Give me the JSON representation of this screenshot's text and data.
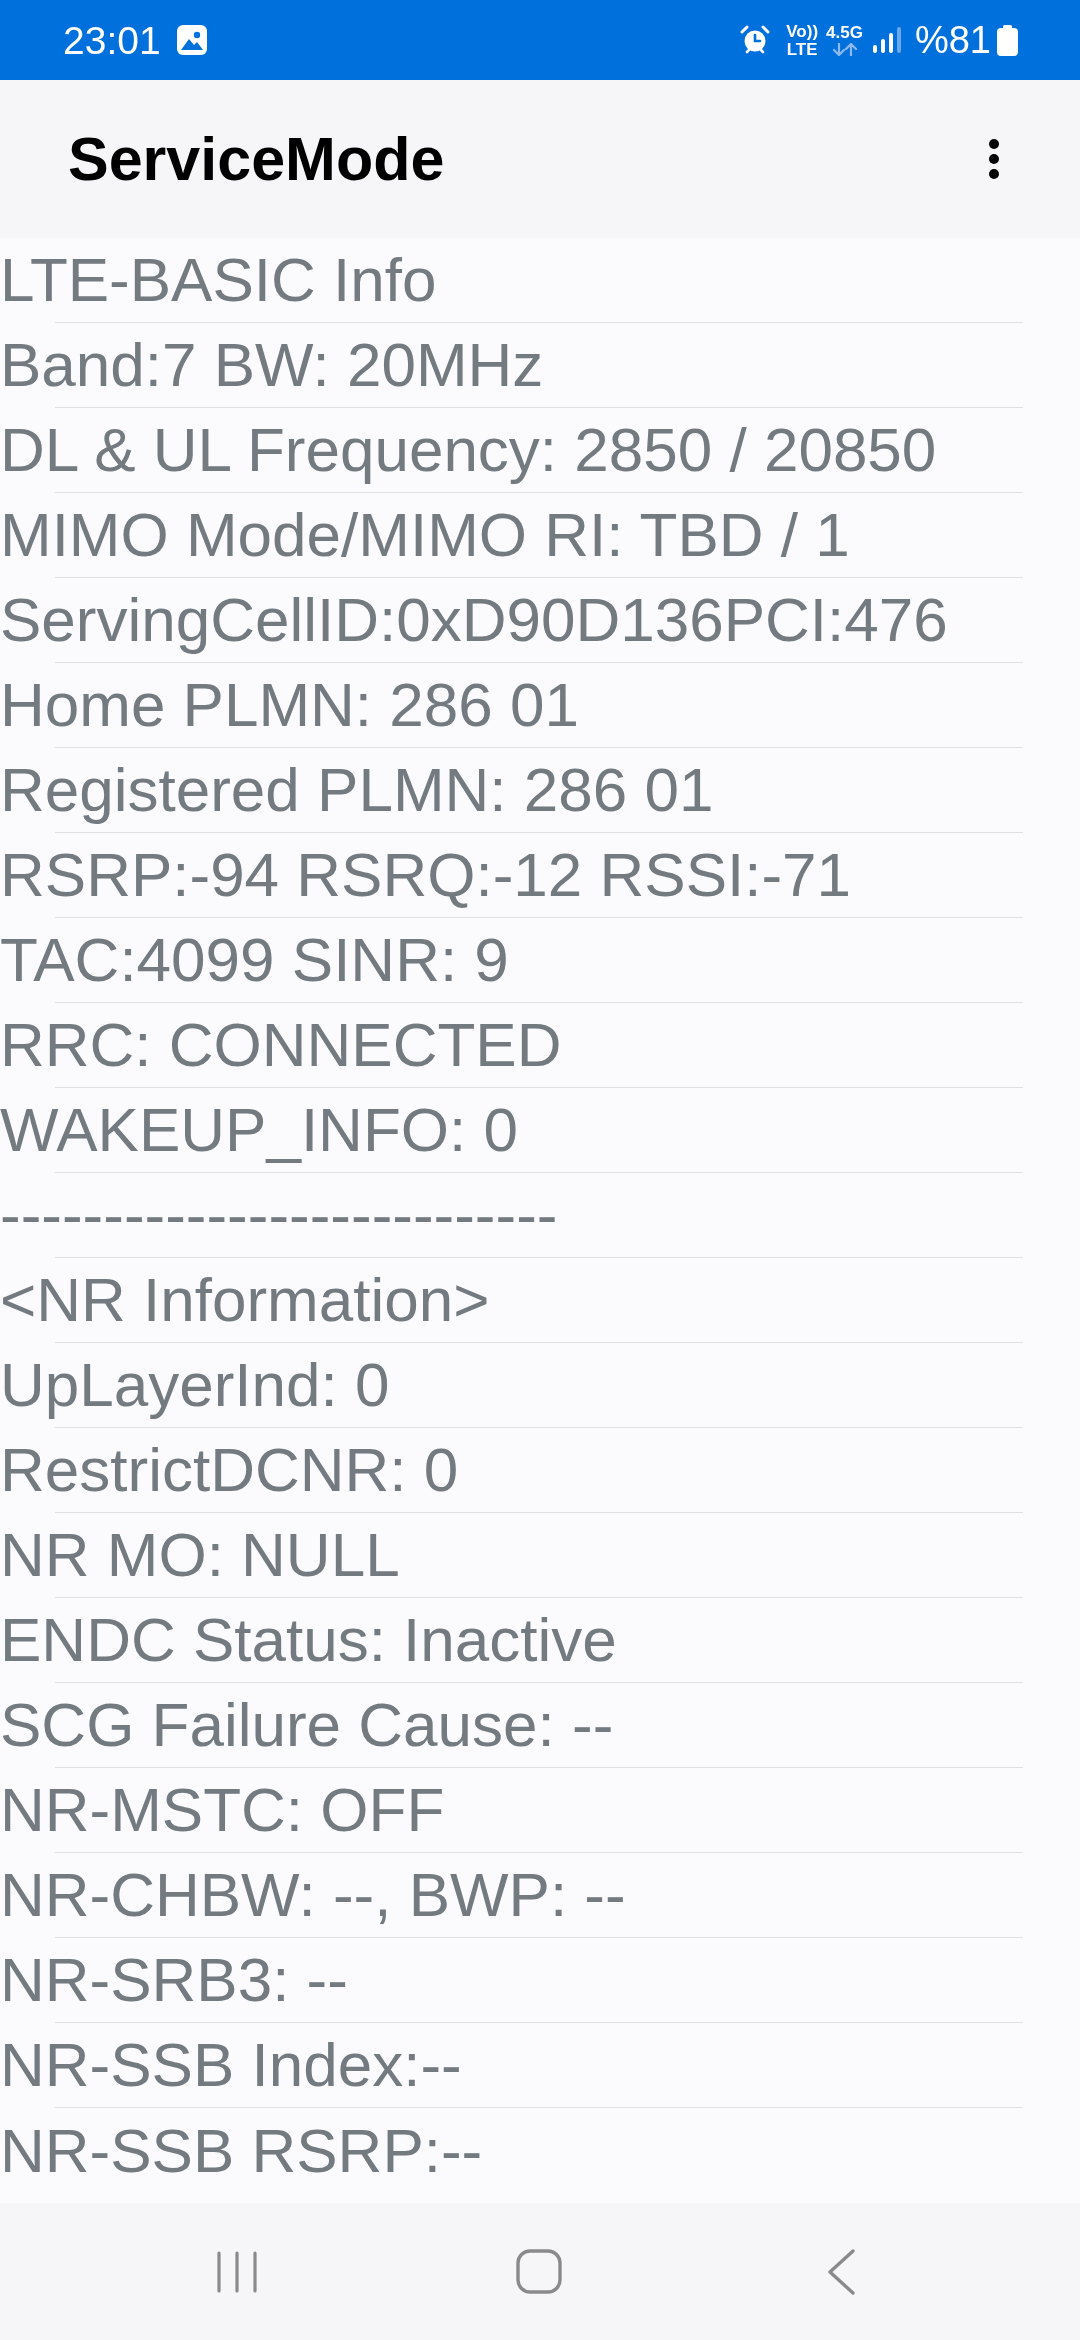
{
  "status_bar": {
    "time": "23:01",
    "volte": [
      "Vo))",
      "LTE"
    ],
    "network": "4.5G",
    "battery": "%81"
  },
  "app_bar": {
    "title": "ServiceMode"
  },
  "lines": [
    "LTE-BASIC Info",
    "Band:7 BW: 20MHz",
    "DL & UL Frequency: 2850 / 20850",
    "MIMO Mode/MIMO RI: TBD / 1",
    "ServingCellID:0xD90D136PCI:476",
    "Home PLMN: 286 01",
    "Registered PLMN: 286 01",
    "RSRP:-94 RSRQ:-12 RSSI:-71",
    "TAC:4099 SINR: 9",
    "RRC: CONNECTED",
    "WAKEUP_INFO: 0",
    "---------------------------",
    "<NR Information>",
    "UpLayerInd: 0",
    "RestrictDCNR: 0",
    "NR MO: NULL",
    "ENDC Status: Inactive",
    "SCG Failure Cause: --",
    "NR-MSTC: OFF",
    "NR-CHBW: --, BWP: --",
    "NR-SRB3: --",
    "NR-SSB Index:--",
    "NR-SSB RSRP:--"
  ]
}
